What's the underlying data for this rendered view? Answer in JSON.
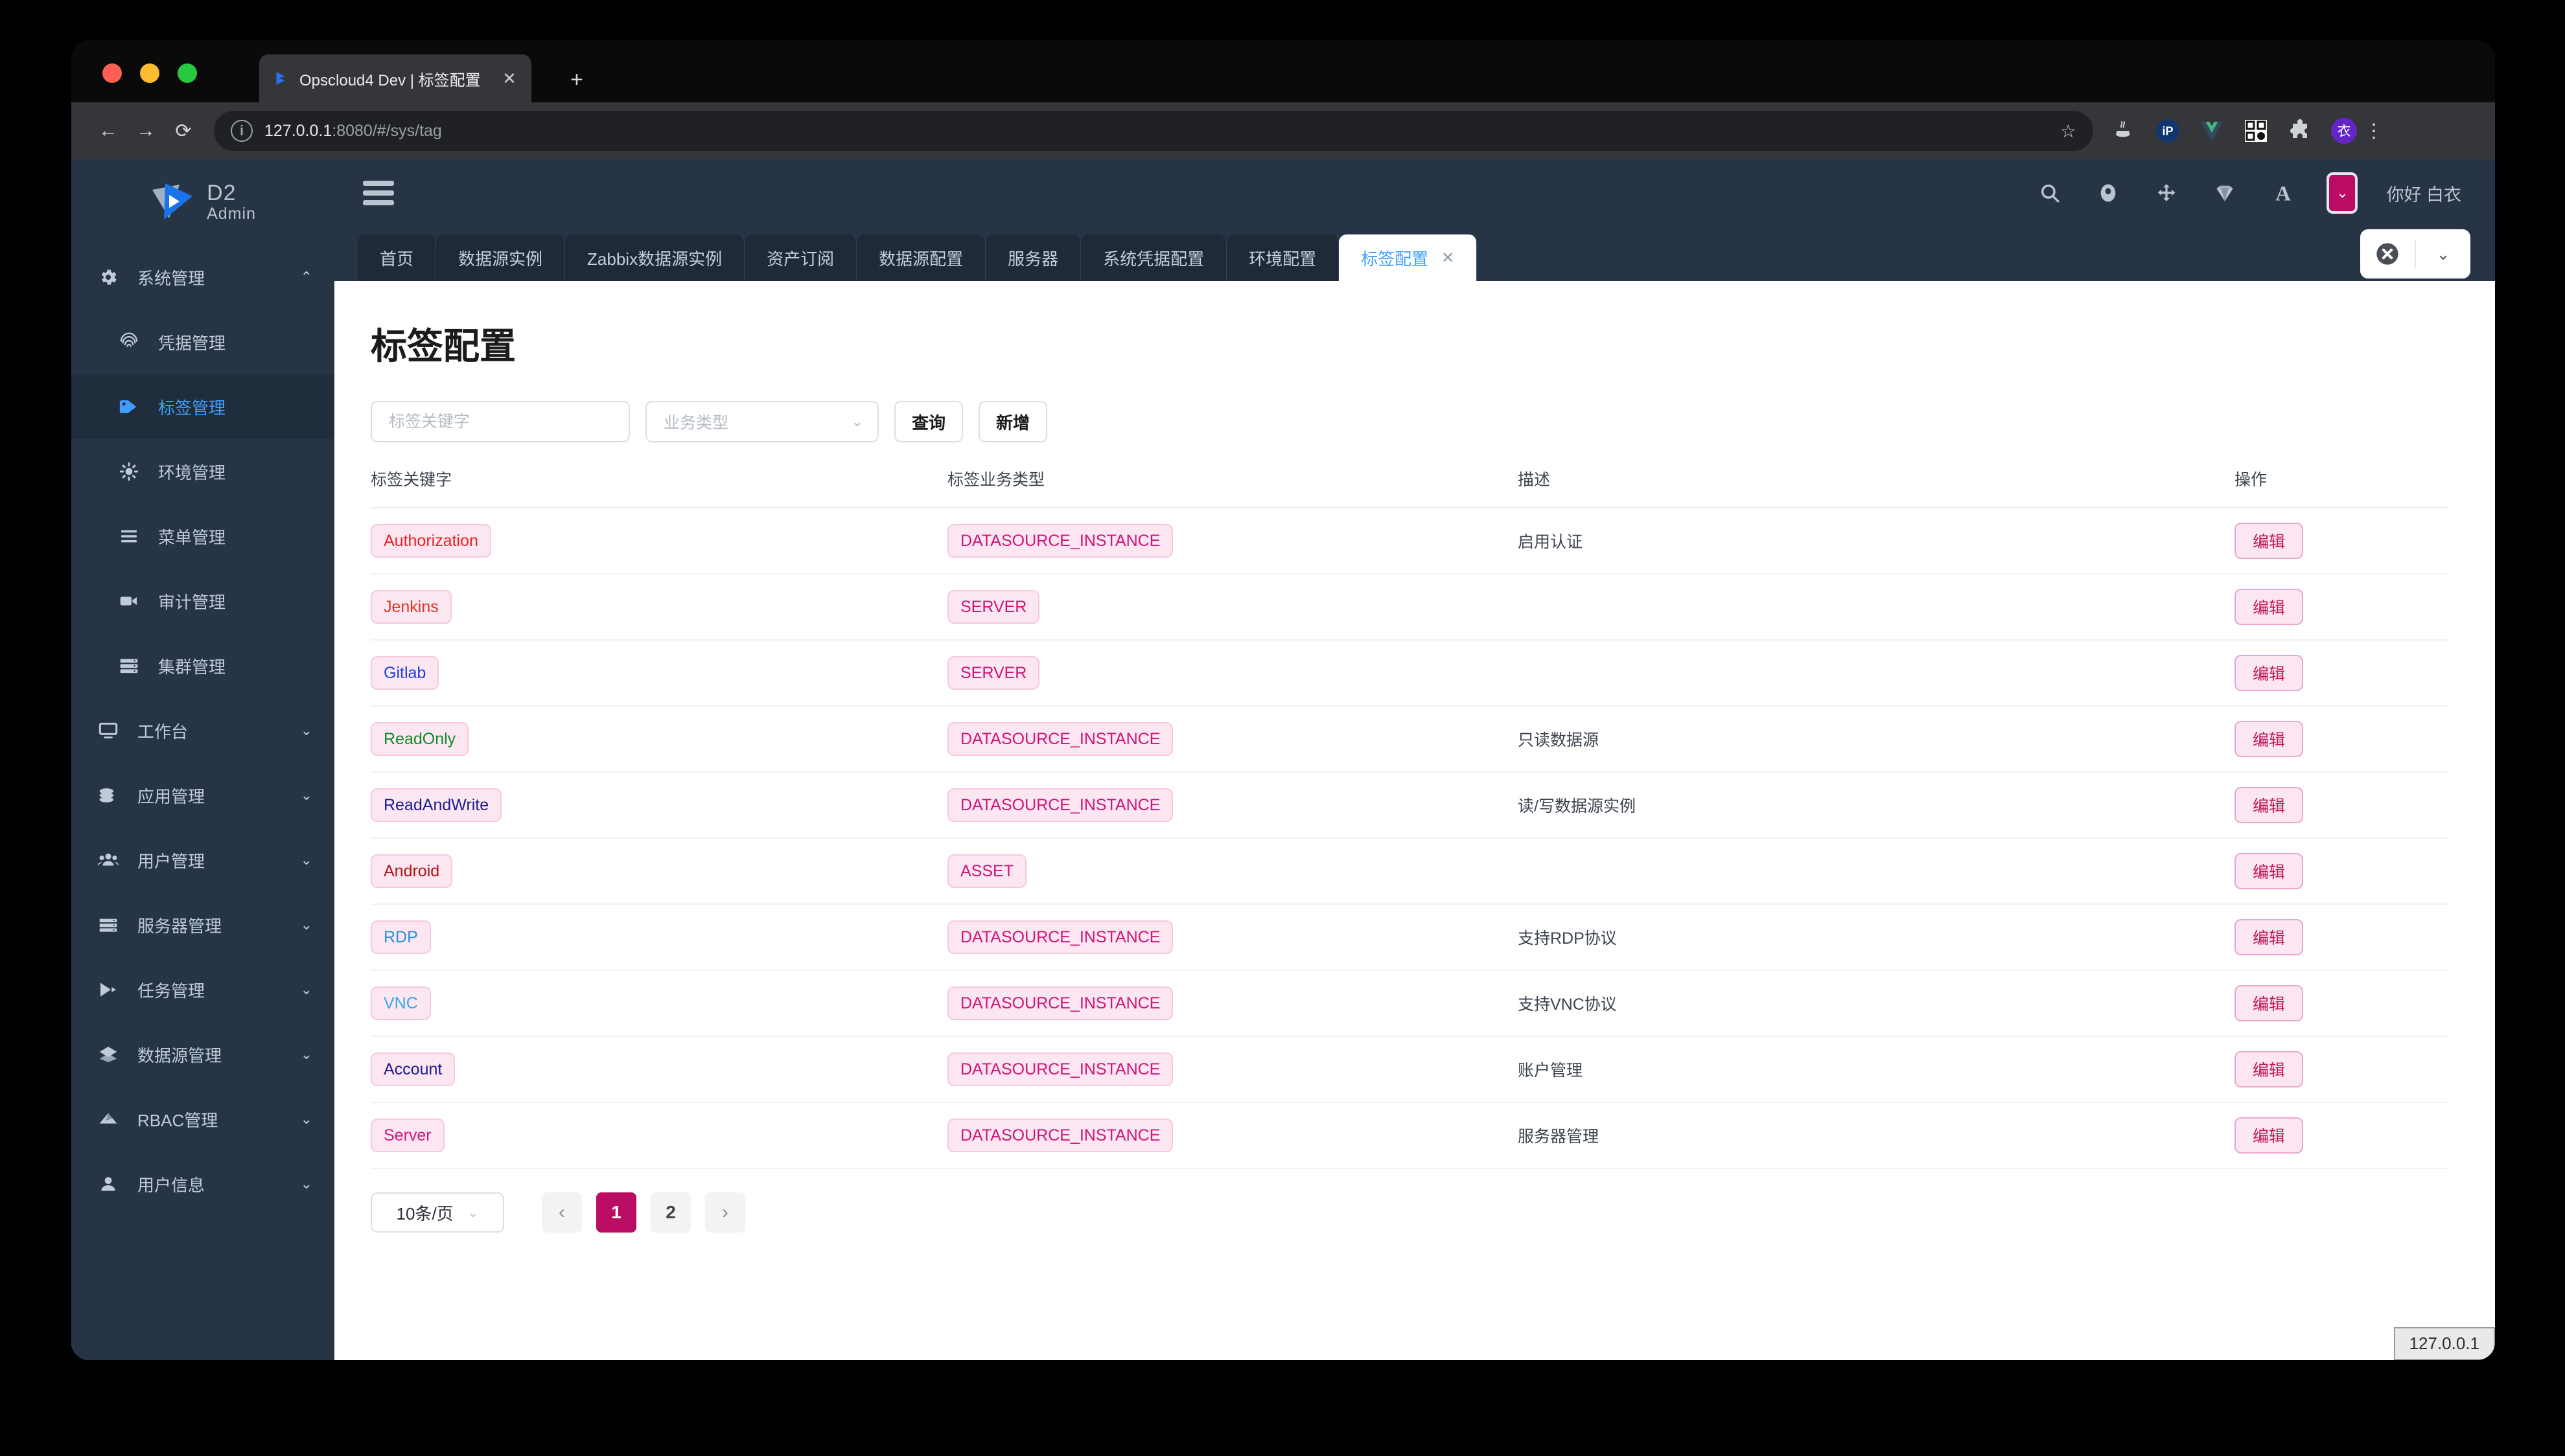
{
  "browser": {
    "tab_title": "Opscloud4 Dev | 标签配置",
    "tab_close": "✕",
    "new_tab": "+",
    "back": "←",
    "forward": "→",
    "reload": "⟳",
    "info_icon": "i",
    "url_host": "127.0.0.1",
    "url_rest": ":8080/#/sys/tag",
    "star": "☆",
    "menu": "⋮",
    "extensions": [
      "java-icon",
      "ip-icon",
      "vue-icon",
      "qrcode-icon",
      "puzzle-extension-icon",
      "profile-avatar-yi"
    ]
  },
  "sidebar": {
    "brand": {
      "line1": "D2",
      "line2": "Admin"
    },
    "items": [
      {
        "label": "系统管理",
        "icon": "gear-icon",
        "level": "top",
        "expanded": true,
        "chev": "⌃",
        "active": false
      },
      {
        "label": "凭据管理",
        "icon": "fingerprint-icon",
        "level": "sub",
        "active": false
      },
      {
        "label": "标签管理",
        "icon": "tag-icon",
        "level": "sub",
        "active": true
      },
      {
        "label": "环境管理",
        "icon": "sun-gear-icon",
        "level": "sub",
        "active": false
      },
      {
        "label": "菜单管理",
        "icon": "menu-lines-icon",
        "level": "sub",
        "active": false
      },
      {
        "label": "审计管理",
        "icon": "video-camera-icon",
        "level": "sub",
        "active": false
      },
      {
        "label": "集群管理",
        "icon": "server-stack-icon",
        "level": "sub",
        "active": false
      },
      {
        "label": "工作台",
        "icon": "monitor-icon",
        "level": "top",
        "chev": "⌄",
        "active": false
      },
      {
        "label": "应用管理",
        "icon": "coins-icon",
        "level": "top",
        "chev": "⌄",
        "active": false
      },
      {
        "label": "用户管理",
        "icon": "users-icon",
        "level": "top",
        "chev": "⌄",
        "active": false
      },
      {
        "label": "服务器管理",
        "icon": "server-icon",
        "level": "top",
        "chev": "⌄",
        "active": false
      },
      {
        "label": "任务管理",
        "icon": "play-arrow-icon",
        "level": "top",
        "chev": "⌄",
        "active": false
      },
      {
        "label": "数据源管理",
        "icon": "datasource-icon",
        "level": "top",
        "chev": "⌄",
        "active": false
      },
      {
        "label": "RBAC管理",
        "icon": "rbac-icon",
        "level": "top",
        "chev": "⌄",
        "active": false
      },
      {
        "label": "用户信息",
        "icon": "person-icon",
        "level": "top",
        "chev": "⌄",
        "active": false
      }
    ]
  },
  "appheader": {
    "hamburger": "hamburger-icon",
    "icons": [
      "search-icon",
      "record-icon",
      "fullscreen-move-icon",
      "gem-icon",
      "font-size-icon"
    ],
    "theme_chip": "⌄",
    "greeting": "你好 白衣"
  },
  "tabbar": {
    "tabs": [
      {
        "label": "首页",
        "active": false,
        "closable": false
      },
      {
        "label": "数据源实例",
        "active": false,
        "closable": false
      },
      {
        "label": "Zabbix数据源实例",
        "active": false,
        "closable": false
      },
      {
        "label": "资产订阅",
        "active": false,
        "closable": false
      },
      {
        "label": "数据源配置",
        "active": false,
        "closable": false
      },
      {
        "label": "服务器",
        "active": false,
        "closable": false
      },
      {
        "label": "系统凭据配置",
        "active": false,
        "closable": false
      },
      {
        "label": "环境配置",
        "active": false,
        "closable": false
      },
      {
        "label": "标签配置",
        "active": true,
        "closable": true,
        "close": "✕"
      }
    ],
    "control": {
      "close_icon": "close-circle-icon",
      "chev": "⌄"
    }
  },
  "page": {
    "title": "标签配置",
    "filters": {
      "keyword_placeholder": "标签关键字",
      "keyword_value": "",
      "type_select_value": "业务类型",
      "type_select_chev": "⌄",
      "query_button": "查询",
      "add_button": "新增"
    },
    "table": {
      "columns": [
        "标签关键字",
        "标签业务类型",
        "描述",
        "操作"
      ],
      "edit_label": "编辑",
      "rows": [
        {
          "key": "Authorization",
          "key_color": "#f01f1f",
          "type": "DATASOURCE_INSTANCE",
          "type_color": "#cf1579",
          "desc": "启用认证"
        },
        {
          "key": "Jenkins",
          "key_color": "#e2321f",
          "type": "SERVER",
          "type_color": "#cf1579",
          "desc": ""
        },
        {
          "key": "Gitlab",
          "key_color": "#1d3fe0",
          "type": "SERVER",
          "type_color": "#cf1579",
          "desc": ""
        },
        {
          "key": "ReadOnly",
          "key_color": "#0f8b2a",
          "type": "DATASOURCE_INSTANCE",
          "type_color": "#cf1579",
          "desc": "只读数据源"
        },
        {
          "key": "ReadAndWrite",
          "key_color": "#1b1b8f",
          "type": "DATASOURCE_INSTANCE",
          "type_color": "#cf1579",
          "desc": "读/写数据源实例"
        },
        {
          "key": "Android",
          "key_color": "#b01414",
          "type": "ASSET",
          "type_color": "#cf1579",
          "desc": ""
        },
        {
          "key": "RDP",
          "key_color": "#2a8fd6",
          "type": "DATASOURCE_INSTANCE",
          "type_color": "#cf1579",
          "desc": "支持RDP协议"
        },
        {
          "key": "VNC",
          "key_color": "#35a6f0",
          "type": "DATASOURCE_INSTANCE",
          "type_color": "#cf1579",
          "desc": "支持VNC协议"
        },
        {
          "key": "Account",
          "key_color": "#1b1b8f",
          "type": "DATASOURCE_INSTANCE",
          "type_color": "#cf1579",
          "desc": "账户管理"
        },
        {
          "key": "Server",
          "key_color": "#d4157e",
          "type": "DATASOURCE_INSTANCE",
          "type_color": "#cf1579",
          "desc": "服务器管理"
        }
      ]
    },
    "pagination": {
      "page_size_label": "10条/页",
      "page_size_chev": "⌄",
      "prev": "‹",
      "next": "›",
      "pages": [
        "1",
        "2"
      ],
      "current_page": "1"
    }
  },
  "status": {
    "text": "127.0.0.1"
  },
  "colors": {
    "accent": "#ba0c63",
    "link_blue": "#409eff",
    "sidebar_bg": "#263445",
    "sidebar_active_bg": "#1f2d3d",
    "tag_bg": "#fbe6f1",
    "tag_border": "#f5c9e1"
  }
}
